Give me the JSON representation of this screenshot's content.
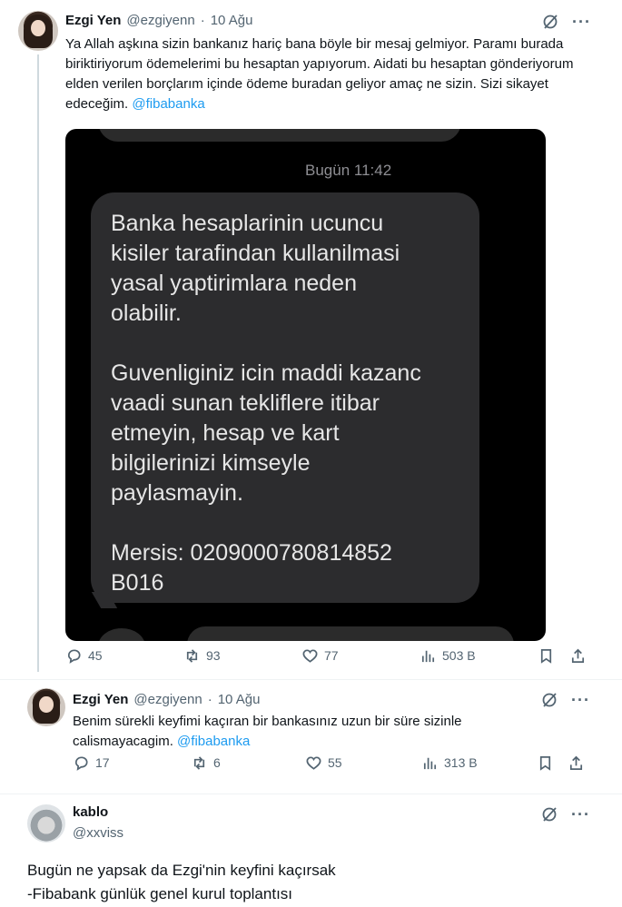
{
  "tweet1": {
    "name": "Ezgi Yen",
    "handle": "@ezgiyenn",
    "dot": "·",
    "date": "10 Ağu",
    "text": "Ya Allah aşkına sizin bankanız hariç bana böyle bir mesaj gelmiyor. Paramı burada biriktiriyorum ödemelerimi bu hesaptan yapıyorum. Aidati bu hesaptan gönderiyorum elden verilen borçlarım içinde ödeme buradan geliyor amaç ne sizin. Sizi sikayet edeceğim.",
    "mention": "@fibabanka",
    "sms": {
      "time": "Bugün 11:42",
      "message": "Banka hesaplarinin ucuncu\nkisiler tarafindan kullanilmasi\nyasal yaptirimlara neden\nolabilir.\n\nGuvenliginiz icin maddi kazanc\nvaadi sunan tekliflere itibar\netmeyin, hesap ve kart\nbilgilerinizi kimseyle\npaylasmayin.\n\nMersis: 0209000780814852\nB016"
    },
    "stats": {
      "replies": "45",
      "reposts": "93",
      "likes": "77",
      "views": "503 B"
    }
  },
  "tweet2": {
    "name": "Ezgi Yen",
    "handle": "@ezgiyenn",
    "dot": "·",
    "date": "10 Ağu",
    "text": "Benim sürekli keyfimi kaçıran bir bankasınız uzun bir süre sizinle calismayacagim.",
    "mention": "@fibabanka",
    "stats": {
      "replies": "17",
      "reposts": "6",
      "likes": "55",
      "views": "313 B"
    }
  },
  "tweet3": {
    "name": "kablo",
    "handle": "@xxviss",
    "text_line1": "Bugün ne yapsak da Ezgi'nin keyfini kaçırsak",
    "text_line2": "-Fibabank günlük genel kurul toplantısı"
  },
  "icons": {
    "reply": "reply-icon",
    "repost": "repost-icon",
    "like": "heart-icon",
    "views": "analytics-icon",
    "bookmark": "bookmark-icon",
    "share": "share-icon",
    "grok": "grok-icon",
    "more": "more-icon"
  },
  "colors": {
    "accent": "#1d9bf0",
    "text": "#0f1419",
    "muted": "#536471"
  }
}
